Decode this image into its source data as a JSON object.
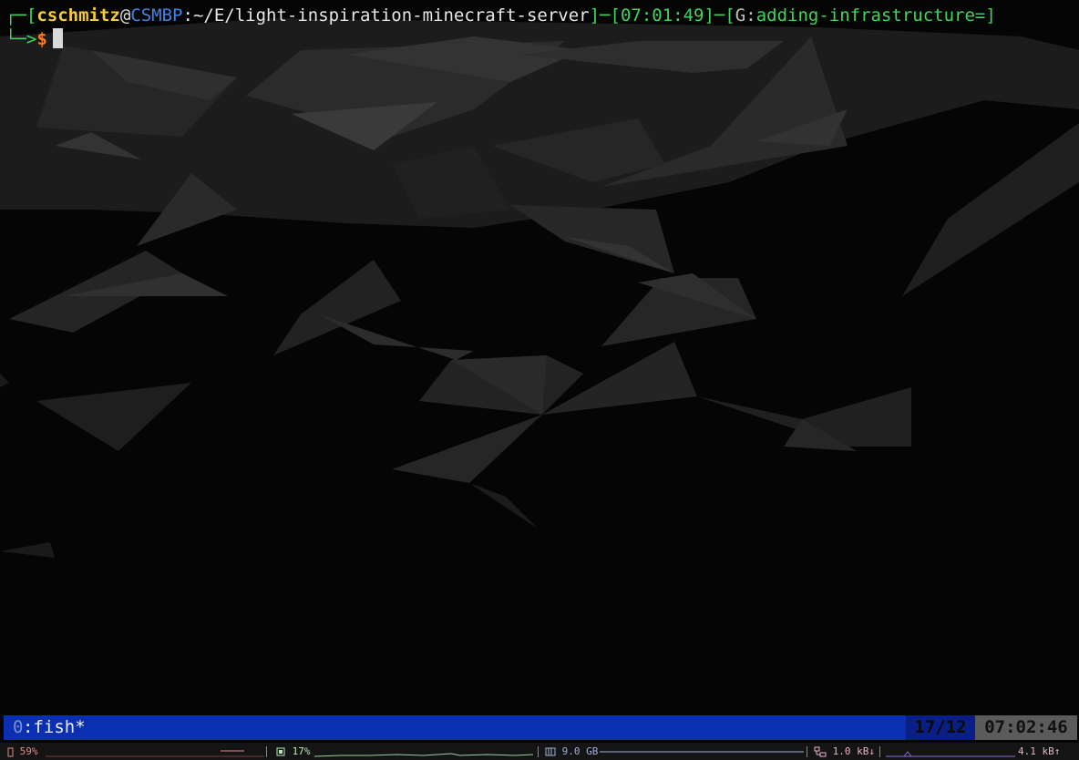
{
  "prompt": {
    "user": "cschmitz",
    "at": "@",
    "host": "CSMBP",
    "path": ":~/E/light-inspiration-minecraft-server",
    "time": "07:01:49",
    "git_prefix": "G:",
    "branch": "adding-infrastructure=",
    "symbol": "$"
  },
  "tmux": {
    "window_index": "0",
    "window_name": ":fish*",
    "pane": "17/12",
    "clock": "07:02:46"
  },
  "stats": {
    "battery": "59%",
    "cpu": "17%",
    "memory": "9.0 GB",
    "net_down": "1.0 kB↓",
    "net_up": "4.1 kB↑"
  },
  "colors": {
    "prompt_green": "#3fd45a",
    "user_yellow": "#f2cc3a",
    "host_blue": "#3c84e8",
    "dollar_orange": "#ff7a1a",
    "tmux_bar": "#0a2fb0"
  },
  "icons": [
    "battery-icon",
    "cpu-icon",
    "memory-icon",
    "network-icon"
  ]
}
